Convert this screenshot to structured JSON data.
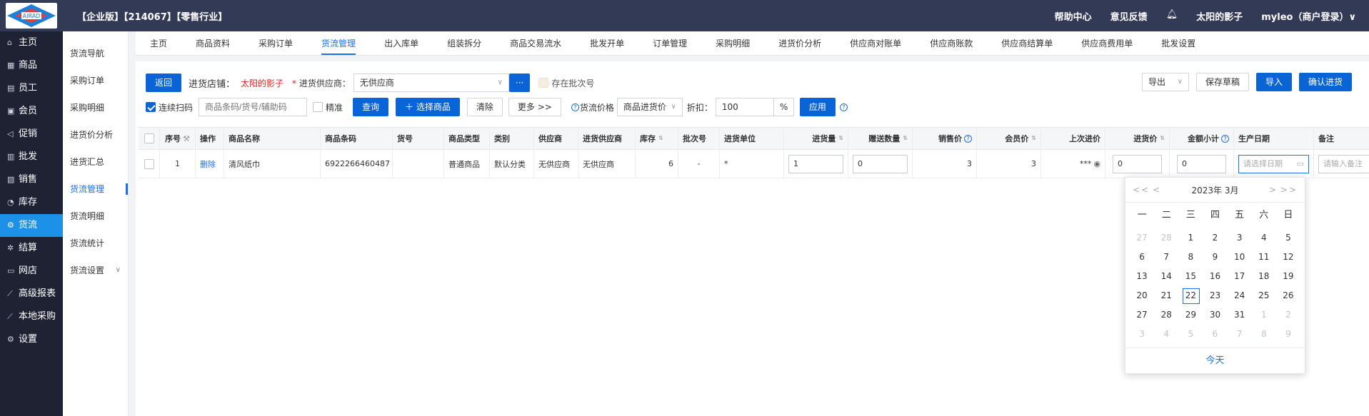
{
  "header": {
    "title": "【企业版】【214067】【零售行业】",
    "logo_text": "AIRAD",
    "right": {
      "help": "帮助中心",
      "feedback": "意见反馈",
      "store": "太阳的影子",
      "user": "myleo（商户登录）∨"
    }
  },
  "sidebar": {
    "items": [
      {
        "label": "主页",
        "icon": "home-icon"
      },
      {
        "label": "商品",
        "icon": "goods-icon"
      },
      {
        "label": "员工",
        "icon": "staff-icon"
      },
      {
        "label": "会员",
        "icon": "member-icon"
      },
      {
        "label": "促销",
        "icon": "promo-icon"
      },
      {
        "label": "批发",
        "icon": "wholesale-icon"
      },
      {
        "label": "销售",
        "icon": "sales-icon"
      },
      {
        "label": "库存",
        "icon": "stock-icon"
      },
      {
        "label": "货流",
        "icon": "flow-icon"
      },
      {
        "label": "结算",
        "icon": "settle-icon"
      },
      {
        "label": "网店",
        "icon": "shop-icon"
      },
      {
        "label": "高级报表",
        "icon": "report-icon"
      },
      {
        "label": "本地采购",
        "icon": "purchase-icon"
      },
      {
        "label": "设置",
        "icon": "settings-icon"
      }
    ],
    "active_index": 8
  },
  "subnav": {
    "items": [
      {
        "label": "货流导航"
      },
      {
        "label": "采购订单"
      },
      {
        "label": "采购明细"
      },
      {
        "label": "进货价分析"
      },
      {
        "label": "进货汇总"
      },
      {
        "label": "货流管理"
      },
      {
        "label": "货流明细"
      },
      {
        "label": "货流统计"
      },
      {
        "label": "货流设置"
      }
    ],
    "active_index": 5
  },
  "tabs": {
    "items": [
      "主页",
      "商品资料",
      "采购订单",
      "货流管理",
      "出入库单",
      "组装拆分",
      "商品交易流水",
      "批发开单",
      "订单管理",
      "采购明细",
      "进货价分析",
      "供应商对账单",
      "供应商账款",
      "供应商结算单",
      "供应商费用单",
      "批发设置"
    ],
    "active_index": 3
  },
  "toolbar": {
    "back": "返回",
    "store_label": "进货店铺：",
    "store_value": "太阳的影子",
    "supplier_label": "进货供应商：",
    "supplier_value": "无供应商",
    "supplier_more": "···",
    "batch_label": "存在批次号",
    "export": "导出",
    "save_draft": "保存草稿",
    "import": "导入",
    "confirm": "确认进货",
    "continuous_scan": "连续扫码",
    "search_placeholder": "商品条码/货号/辅助码",
    "exact": "精准",
    "query": "查询",
    "select_goods": "＋ 选择商品",
    "clear": "清除",
    "more": "更多 >>",
    "price_label": "货流价格",
    "price_value": "商品进货价",
    "discount_label": "折扣：",
    "discount_value": "100",
    "percent": "%",
    "apply": "应用"
  },
  "table": {
    "headers": [
      "",
      "序号",
      "操作",
      "商品名称",
      "商品条码",
      "货号",
      "商品类型",
      "类别",
      "供应商",
      "进货供应商",
      "库存",
      "批次号",
      "进货单位",
      "进货量",
      "赠送数量",
      "销售价",
      "会员价",
      "上次进价",
      "进货价",
      "金额小计",
      "生产日期",
      "备注"
    ],
    "rows": [
      {
        "index": "1",
        "action": "删除",
        "name": "清风纸巾",
        "barcode": "6922266460487",
        "sku": "",
        "type": "普通商品",
        "category": "默认分类",
        "supplier": "无供应商",
        "in_supplier": "无供应商",
        "stock": "6",
        "batch": "-",
        "unit": "*",
        "qty": "1",
        "gift_qty": "0",
        "sale_price": "3",
        "member_price": "3",
        "last_price": "***",
        "price": "0",
        "subtotal": "0",
        "date_placeholder": "请选择日期",
        "note_placeholder": "请输入备注"
      }
    ]
  },
  "datepicker": {
    "year_month": "2023年  3月",
    "prev_year": "<<",
    "prev_month": "<",
    "next_month": ">",
    "next_year": ">>",
    "weekdays": [
      "一",
      "二",
      "三",
      "四",
      "五",
      "六",
      "日"
    ],
    "weeks": [
      [
        "27",
        "28",
        "1",
        "2",
        "3",
        "4",
        "5"
      ],
      [
        "6",
        "7",
        "8",
        "9",
        "10",
        "11",
        "12"
      ],
      [
        "13",
        "14",
        "15",
        "16",
        "17",
        "18",
        "19"
      ],
      [
        "20",
        "21",
        "22",
        "23",
        "24",
        "25",
        "26"
      ],
      [
        "27",
        "28",
        "29",
        "30",
        "31",
        "1",
        "2"
      ],
      [
        "3",
        "4",
        "5",
        "6",
        "7",
        "8",
        "9"
      ]
    ],
    "today_label": "今天",
    "selected": "22"
  }
}
